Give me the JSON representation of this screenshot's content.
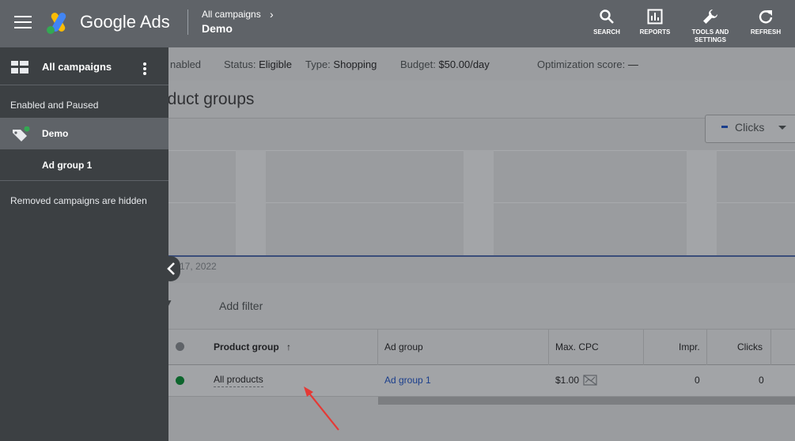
{
  "topbar": {
    "brand": "Google Ads",
    "breadcrumb_parent": "All campaigns",
    "breadcrumb_chevron": "›",
    "breadcrumb_current": "Demo",
    "tools": [
      {
        "label": "SEARCH",
        "icon": "search-icon"
      },
      {
        "label": "REPORTS",
        "icon": "reports-icon"
      },
      {
        "label": "TOOLS AND",
        "label2": "SETTINGS",
        "icon": "wrench-icon"
      },
      {
        "label": "REFRESH",
        "icon": "refresh-icon"
      }
    ]
  },
  "status": {
    "enabled_partial": "nabled",
    "status_label": "Status:",
    "status_value": "Eligible",
    "type_label": "Type:",
    "type_value": "Shopping",
    "budget_label": "Budget:",
    "budget_value": "$50.00/day",
    "opt_label": "Optimization score:",
    "opt_value": "—"
  },
  "page_title_partial": "oduct groups",
  "chart": {
    "metric_dropdown": "Clicks",
    "date_label_partial": "ar 17, 2022"
  },
  "filter": {
    "icon": "filter-icon",
    "add_filter": "Add filter"
  },
  "table": {
    "columns": [
      "Product group",
      "Ad group",
      "Max. CPC",
      "Impr.",
      "Clicks"
    ],
    "sort_arrow": "↑",
    "rows": [
      {
        "product_group": "All products",
        "ad_group": "Ad group 1",
        "max_cpc": "$1.00",
        "impr": "0",
        "clicks": "0"
      }
    ]
  },
  "sidebar": {
    "title": "All campaigns",
    "section": "Enabled and Paused",
    "campaign": "Demo",
    "ad_group": "Ad group 1",
    "removed_note": "Removed campaigns are hidden"
  },
  "colors": {
    "topbar": "#5f6368",
    "sidebar": "#3c4043",
    "accent_blue": "#1a73e8",
    "status_green": "#0d652d",
    "annotation_red": "#e53935"
  }
}
